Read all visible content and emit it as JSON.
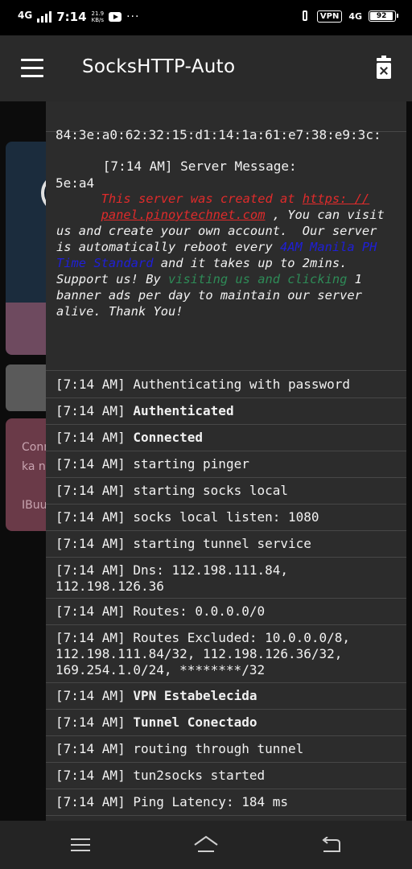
{
  "status_bar": {
    "network_left": "4G",
    "time": "7:14",
    "speed_value": "21.9",
    "speed_unit": "KB/s",
    "vpn": "VPN",
    "network_right": "4G",
    "battery": "92"
  },
  "app_bar": {
    "title": "SocksHTTP-Auto"
  },
  "log": {
    "clipped_line_1": "84:3e:a0:62:32:15:d1:14:1a:61:e7:38:e9:3c:",
    "clipped_line_2": "5e:a4",
    "server_header": "[7:14 AM] Server Message:",
    "server_message": {
      "p1": "This server was created at ",
      "link": "https: //",
      "link2": "panel.pinoytechnet.com",
      "p2": " , You can visit us and create your own account.  Our server is automatically reboot every ",
      "blue1": "4AM Manila PH Time Standard",
      "p3": " and it takes up to 2mins. Support us! By ",
      "green1": "visiting us and clicking",
      "p4": " 1 banner ads per day to maintain our server alive. Thank You!"
    },
    "entries": [
      {
        "ts": "[7:14 AM]",
        "msg": "Authenticating with password",
        "bold": false
      },
      {
        "ts": "[7:14 AM]",
        "msg": "Authenticated",
        "bold": true
      },
      {
        "ts": "[7:14 AM]",
        "msg": "Connected",
        "bold": true
      },
      {
        "ts": "[7:14 AM]",
        "msg": "starting pinger",
        "bold": false
      },
      {
        "ts": "[7:14 AM]",
        "msg": "starting socks local",
        "bold": false
      },
      {
        "ts": "[7:14 AM]",
        "msg": "socks local listen: 1080",
        "bold": false
      },
      {
        "ts": "[7:14 AM]",
        "msg": "starting tunnel service",
        "bold": false
      },
      {
        "ts": "[7:14 AM]",
        "msg": "Dns: 112.198.111.84,\n112.198.126.36",
        "bold": false
      },
      {
        "ts": "[7:14 AM]",
        "msg": "Routes: 0.0.0.0/0",
        "bold": false
      },
      {
        "ts": "[7:14 AM]",
        "msg": "Routes Excluded: 10.0.0.0/8,\n112.198.111.84/32, 112.198.126.36/32,\n169.254.1.0/24, ********/32",
        "bold": false
      },
      {
        "ts": "[7:14 AM]",
        "msg": "VPN Estabelecida",
        "bold": true
      },
      {
        "ts": "[7:14 AM]",
        "msg": "Tunnel Conectado",
        "bold": true
      },
      {
        "ts": "[7:14 AM]",
        "msg": "routing through tunnel",
        "bold": false
      },
      {
        "ts": "[7:14 AM]",
        "msg": "tun2socks started",
        "bold": false
      },
      {
        "ts": "[7:14 AM]",
        "msg": "Ping Latency: 184 ms",
        "bold": false
      }
    ]
  },
  "background_cards": {
    "card3_line1": "Conn",
    "card3_line2": "ka n",
    "card3_line3": "IBuu"
  },
  "icons": {
    "menu": "hamburger-menu-icon",
    "clear": "trash-icon",
    "nav_recent": "recent-apps-icon",
    "nav_home": "home-icon",
    "nav_back": "back-icon"
  },
  "colors": {
    "app_bar": "#2a2a2a",
    "log_panel": "#2c2c2c",
    "red_text": "#e02b2b",
    "blue_text": "#1f1fd8",
    "green_text": "#2e8b57"
  }
}
